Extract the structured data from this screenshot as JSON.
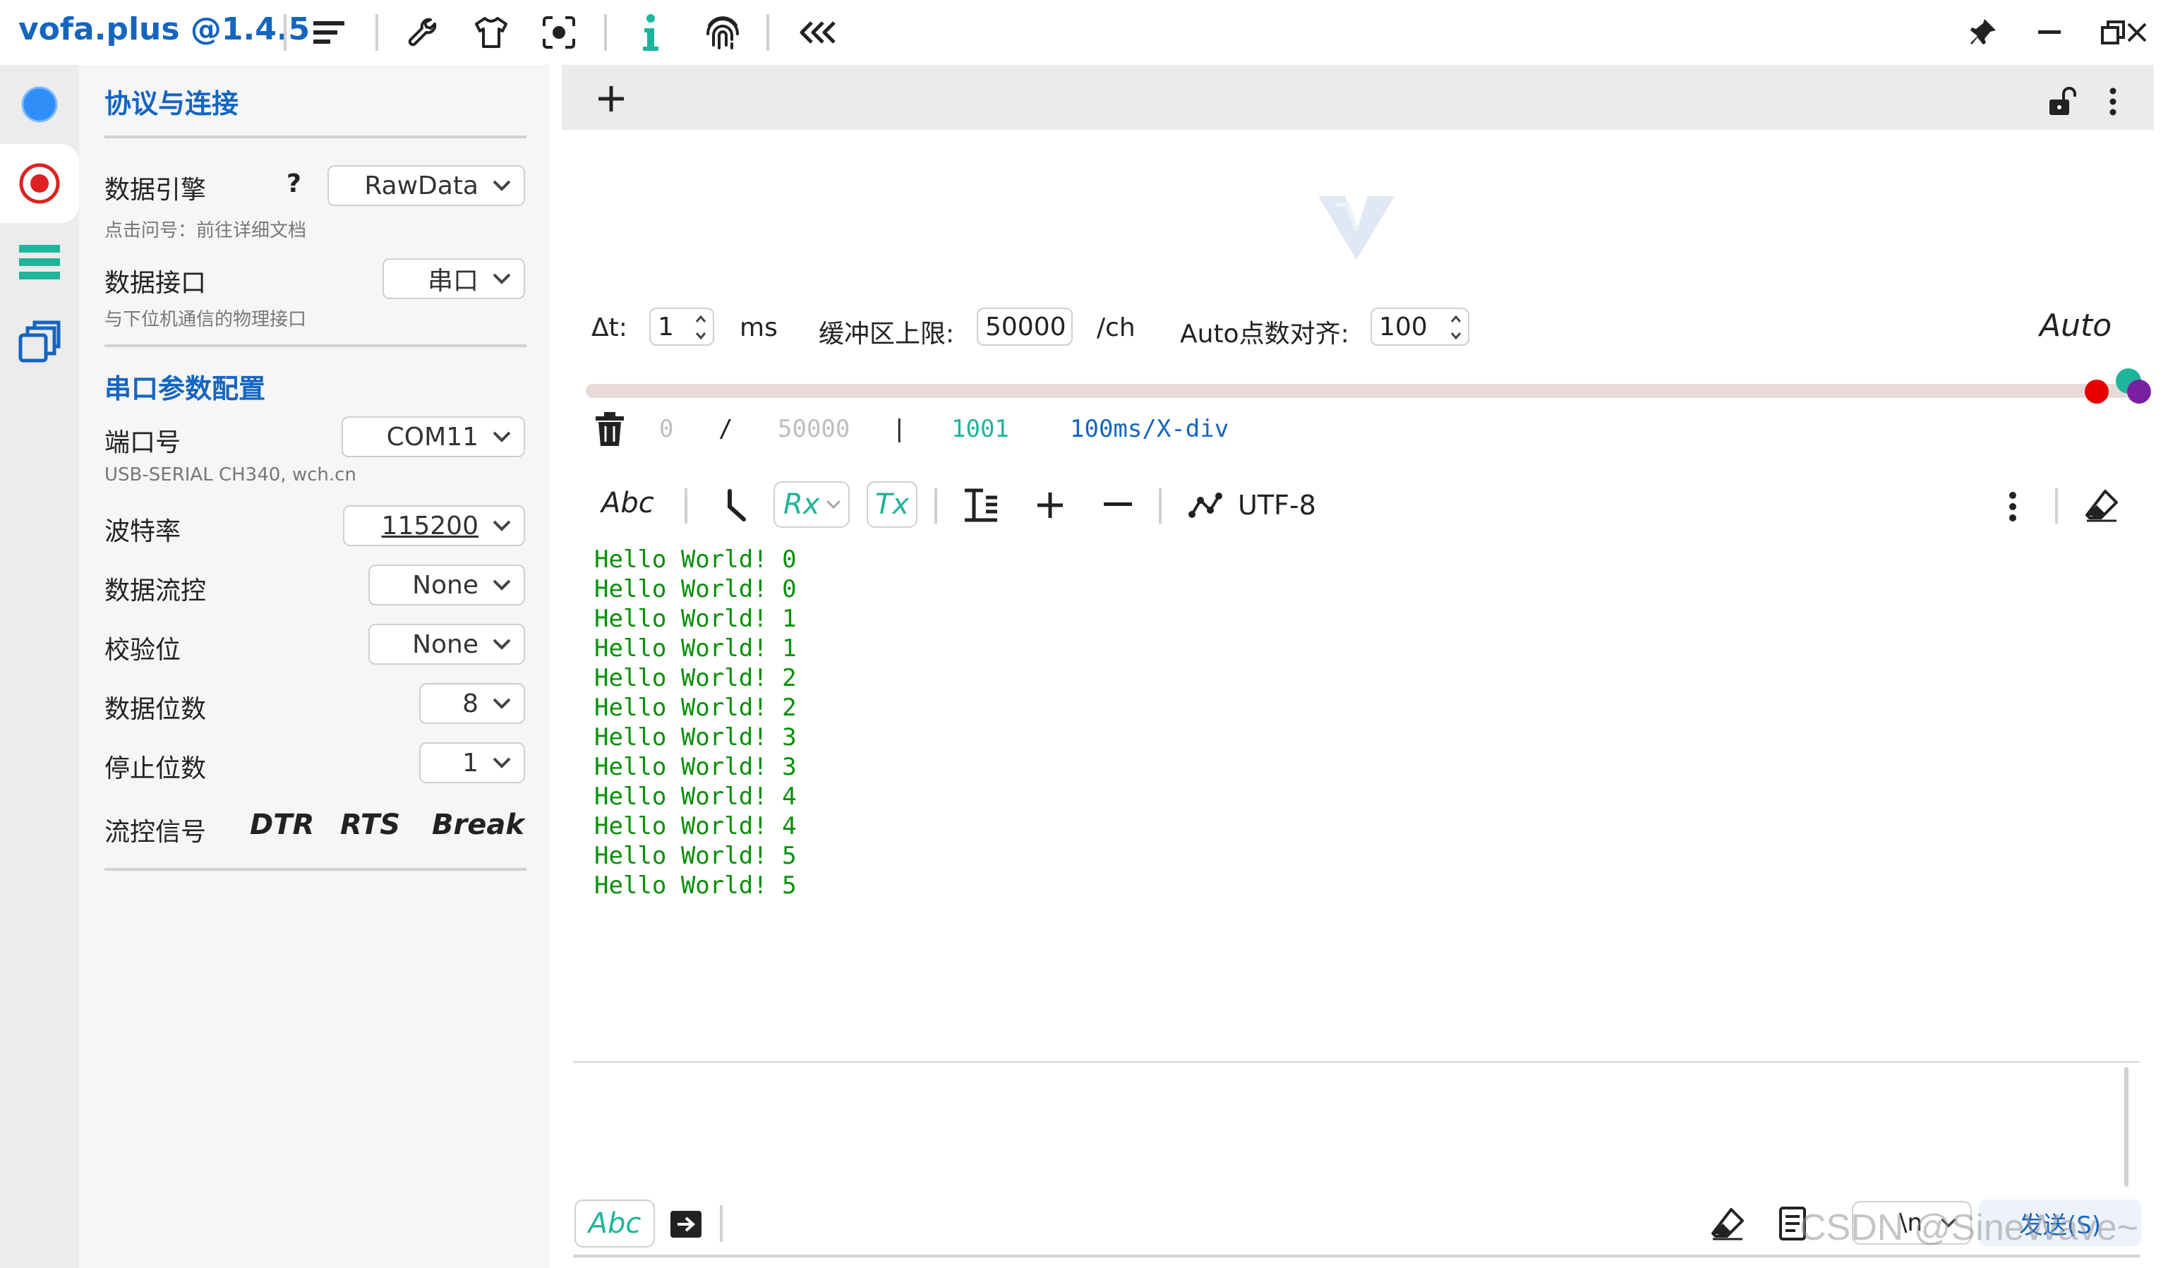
{
  "app": {
    "title": "vofa.plus @1.4.5"
  },
  "toolbar": {
    "icons": [
      "menu-icon",
      "wrench-icon",
      "tshirt-icon",
      "capture-icon",
      "info-icon",
      "fingerprint-icon",
      "double-chevron-left-icon"
    ],
    "window": [
      "pin-icon",
      "minimize-icon",
      "restore-icon",
      "close-icon"
    ]
  },
  "nav": {
    "items": [
      "connection-icon",
      "record-icon",
      "list-icon",
      "copy-windows-icon"
    ]
  },
  "panel": {
    "section_protocol": "协议与连接",
    "engine": {
      "label": "数据引擎",
      "help": "?",
      "value": "RawData",
      "hint": "点击问号：前往详细文档"
    },
    "interface": {
      "label": "数据接口",
      "value": "串口",
      "hint": "与下位机通信的物理接口"
    },
    "section_serial": "串口参数配置",
    "port": {
      "label": "端口号",
      "value": "COM11",
      "hint": "USB-SERIAL CH340, wch.cn"
    },
    "baud": {
      "label": "波特率",
      "value": "115200"
    },
    "flow": {
      "label": "数据流控",
      "value": "None"
    },
    "parity": {
      "label": "校验位",
      "value": "None"
    },
    "databits": {
      "label": "数据位数",
      "value": "8"
    },
    "stopbits": {
      "label": "停止位数",
      "value": "1"
    },
    "signals": {
      "label": "流控信号",
      "dtr": "DTR",
      "rts": "RTS",
      "brk": "Break"
    }
  },
  "scope": {
    "dt_label": "Δt:",
    "dt_value": "1",
    "dt_unit": "ms",
    "buffer_label": "缓冲区上限:",
    "buffer_value": "50000",
    "buffer_unit": "/ch",
    "align_label": "Auto点数对齐:",
    "align_value": "100",
    "auto_label": "Auto",
    "count_current": "0",
    "count_sep": "/",
    "count_max": "50000",
    "bar": "|",
    "points": "1001",
    "div": "100ms/X-div"
  },
  "rx_toolbar": {
    "abc": "Abc",
    "rx": "Rx",
    "tx": "Tx",
    "encoding": "UTF-8"
  },
  "output": [
    "Hello World! 0",
    "Hello World! 0",
    "Hello World! 1",
    "Hello World! 1",
    "Hello World! 2",
    "Hello World! 2",
    "Hello World! 3",
    "Hello World! 3",
    "Hello World! 4",
    "Hello World! 4",
    "Hello World! 5",
    "Hello World! 5"
  ],
  "send": {
    "abc": "Abc",
    "newline": "\\n",
    "send_label": "发送(S)"
  },
  "watermark": "CSDN @SineWave~",
  "colors": {
    "accent": "#1565c0",
    "teal": "#1fb59a",
    "green": "#0a8f0a",
    "red": "#e02020"
  }
}
